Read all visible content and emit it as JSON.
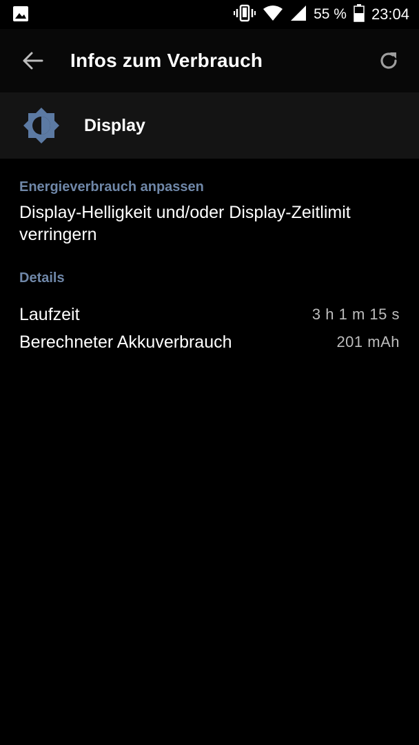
{
  "status_bar": {
    "notification_icon": "image-icon",
    "vibrate_icon": "vibrate-icon",
    "wifi_icon": "wifi-icon",
    "signal_icon": "signal-icon",
    "battery_percent": "55 %",
    "battery_icon": "battery-icon",
    "time": "23:04"
  },
  "toolbar": {
    "back_icon": "arrow-left-icon",
    "title": "Infos zum Verbrauch",
    "refresh_icon": "refresh-icon"
  },
  "app_header": {
    "icon": "brightness-icon",
    "name": "Display"
  },
  "sections": {
    "energy": {
      "header": "Energieverbrauch anpassen",
      "summary": "Display-Helligkeit und/oder Display-Zeitlimit verringern"
    },
    "details": {
      "header": "Details",
      "rows": [
        {
          "label": "Laufzeit",
          "value": "3 h 1 m 15 s"
        },
        {
          "label": "Berechneter Akkuverbrauch",
          "value": "201 mAh"
        }
      ]
    }
  },
  "colors": {
    "background": "#000000",
    "toolbar": "#080808",
    "header_band": "#141414",
    "accent": "#6f87a8",
    "icon_accent": "#5c7aa3",
    "text_primary": "#ffffff",
    "text_secondary": "#bdbdbd"
  }
}
